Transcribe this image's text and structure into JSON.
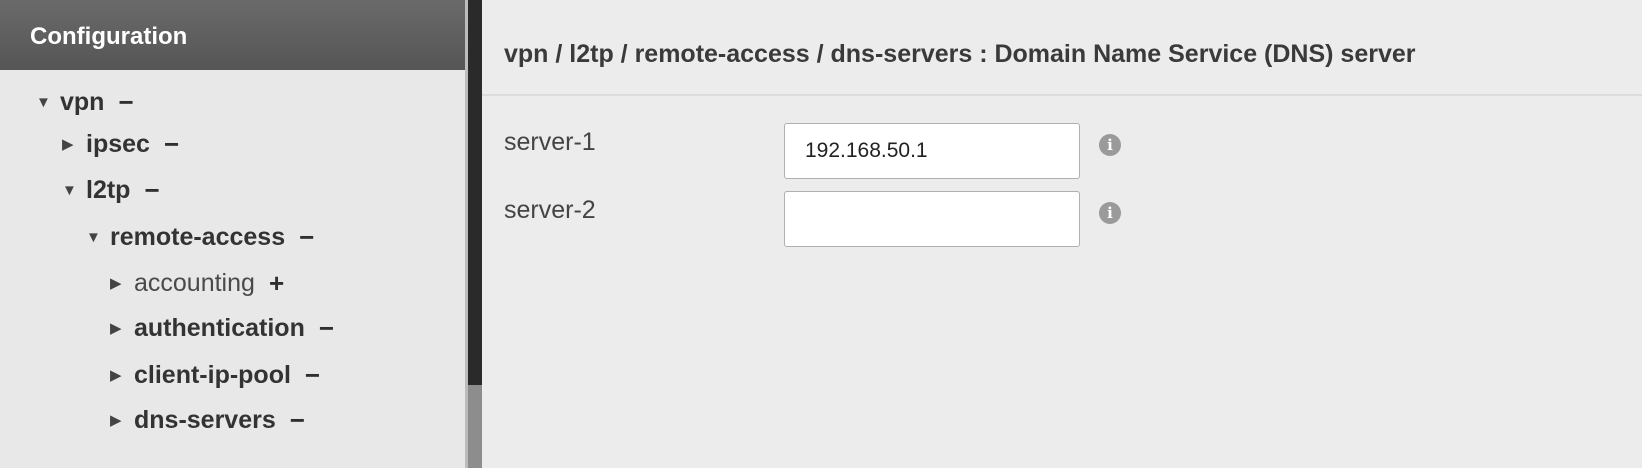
{
  "sidebar": {
    "header": "Configuration",
    "tree": [
      {
        "caret": "▼",
        "label": "vpn",
        "action": "−"
      },
      {
        "caret": "▶",
        "label": "ipsec",
        "action": "−"
      },
      {
        "caret": "▼",
        "label": "l2tp",
        "action": "−"
      },
      {
        "caret": "▼",
        "label": "remote-access",
        "action": "−"
      },
      {
        "caret": "▶",
        "label": "accounting",
        "action": "+"
      },
      {
        "caret": "▶",
        "label": "authentication",
        "action": "−"
      },
      {
        "caret": "▶",
        "label": "client-ip-pool",
        "action": "−"
      },
      {
        "caret": "▶",
        "label": "dns-servers",
        "action": "−"
      }
    ]
  },
  "main": {
    "title": "vpn / l2tp / remote-access / dns-servers : Domain Name Service (DNS) server",
    "fields": [
      {
        "label": "server-1",
        "value": "192.168.50.1",
        "info": "i"
      },
      {
        "label": "server-2",
        "value": "",
        "info": "i"
      }
    ]
  }
}
